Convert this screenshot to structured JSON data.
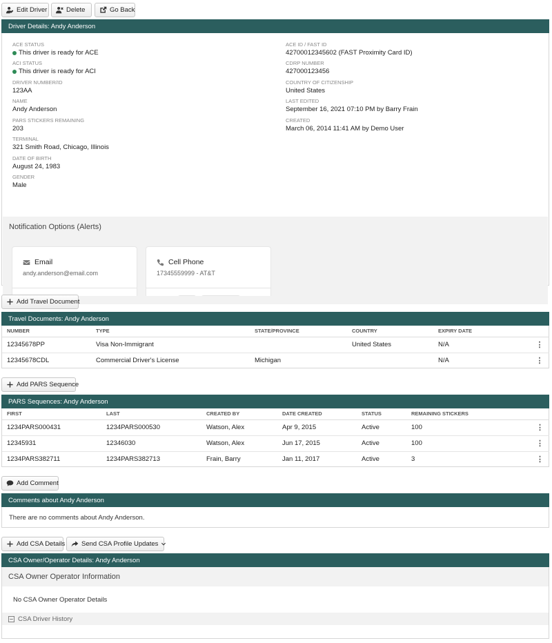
{
  "toolbar": {
    "edit_label": "Edit Driver",
    "delete_label": "Delete",
    "back_label": "Go Back"
  },
  "driver_panel": {
    "title": "Driver Details: Andy Anderson",
    "left": [
      {
        "label": "ACE STATUS",
        "value": "This driver is ready for ACE"
      },
      {
        "label": "ACI STATUS",
        "value": "This driver is ready for ACI"
      },
      {
        "label": "DRIVER NUMBER/ID",
        "value": "123AA"
      },
      {
        "label": "NAME",
        "value": "Andy Anderson"
      },
      {
        "label": "PARS STICKERS REMAINING",
        "value": "203"
      },
      {
        "label": "TERMINAL",
        "value": "321 Smith Road, Chicago, Illinois"
      },
      {
        "label": "DATE OF BIRTH",
        "value": "August 24, 1983"
      },
      {
        "label": "GENDER",
        "value": "Male"
      }
    ],
    "right": [
      {
        "label": "ACE ID / FAST ID",
        "value": "42700012345602 (FAST Proximity Card ID)"
      },
      {
        "label": "CDRP NUMBER",
        "value": "427000123456"
      },
      {
        "label": "COUNTRY OF CITIZENSHIP",
        "value": "United States"
      },
      {
        "label": "LAST EDITED",
        "value": "September 16, 2021 07:10 PM by Barry Frain"
      },
      {
        "label": "CREATED",
        "value": "March 06, 2014 11:41 AM by Demo User"
      }
    ],
    "status_color": "#2e8b57"
  },
  "notifications": {
    "title": "Notification Options (Alerts)",
    "email": {
      "title": "Email",
      "value": "andy.anderson@email.com"
    },
    "phone": {
      "title": "Cell Phone",
      "value": "17345559999 - AT&T"
    }
  },
  "travel": {
    "add_label": "Add Travel Document",
    "title": "Travel Documents: Andy Anderson",
    "columns": [
      "NUMBER",
      "TYPE",
      "STATE/PROVINCE",
      "COUNTRY",
      "EXPIRY DATE"
    ],
    "rows": [
      [
        "12345678PP",
        "Visa Non-Immigrant",
        "",
        "United States",
        "N/A"
      ],
      [
        "12345678CDL",
        "Commercial Driver's License",
        "Michigan",
        "",
        "N/A"
      ]
    ]
  },
  "pars": {
    "add_label": "Add PARS Sequence",
    "title": "PARS Sequences: Andy Anderson",
    "columns": [
      "FIRST",
      "LAST",
      "CREATED BY",
      "DATE CREATED",
      "STATUS",
      "REMAINING STICKERS"
    ],
    "rows": [
      [
        "1234PARS000431",
        "1234PARS000530",
        "Watson, Alex",
        "Apr 9, 2015",
        "Active",
        "100"
      ],
      [
        "12345931",
        "12346030",
        "Watson, Alex",
        "Jun 17, 2015",
        "Active",
        "100"
      ],
      [
        "1234PARS382711",
        "1234PARS382713",
        "Frain, Barry",
        "Jan 11, 2017",
        "Active",
        "3"
      ]
    ]
  },
  "comments": {
    "add_label": "Add Comment",
    "title": "Comments about Andy Anderson",
    "empty": "There are no comments about Andy Anderson."
  },
  "csa": {
    "add_label": "Add CSA Details",
    "send_label": "Send CSA Profile Updates",
    "title": "CSA Owner/Operator Details: Andy Anderson",
    "subheader": "CSA Owner Operator Information",
    "empty": "No CSA Owner Operator Details",
    "history": "CSA Driver History"
  },
  "theme": {
    "header_color": "#2b5e5e"
  }
}
